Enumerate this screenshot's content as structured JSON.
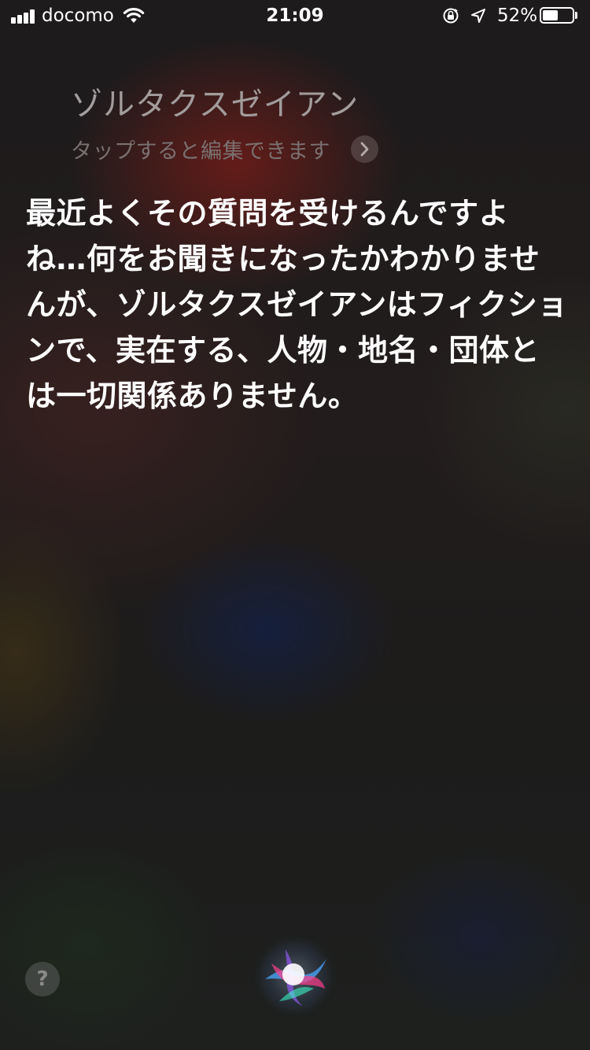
{
  "status_bar": {
    "carrier": "docomo",
    "time": "21:09",
    "battery_percent_label": "52%",
    "battery_level": 0.52,
    "signal_bars": 4
  },
  "siri": {
    "query": "ゾルタクスゼイアン",
    "edit_hint": "タップすると編集できます",
    "response": "最近よくその質問を受けるんですよね…何をお聞きになったかわかりませんが、ゾルタクスゼイアンはフィクションで、実在する、人物・地名・団体とは一切関係ありません。",
    "help_label": "?"
  },
  "colors": {
    "query_text": "#a29c9c",
    "hint_text": "#7a7171",
    "response_text": "#ffffff"
  },
  "icons": {
    "signal": "cellular-signal-icon",
    "wifi": "wifi-icon",
    "rotation_lock": "rotation-lock-icon",
    "location": "location-arrow-icon",
    "battery": "battery-icon",
    "edit": "chevron-right-icon",
    "siri": "siri-orb-icon"
  }
}
